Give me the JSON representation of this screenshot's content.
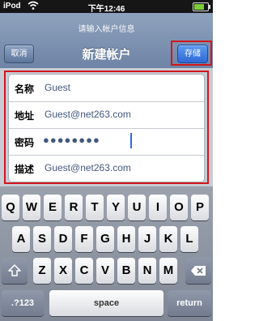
{
  "status": {
    "carrier": "iPod",
    "time": "下午12:46"
  },
  "nav": {
    "prompt": "请输入帐户信息",
    "title": "新建帐户",
    "cancel_label": "取消",
    "save_label": "存储"
  },
  "form": {
    "rows": [
      {
        "label": "名称",
        "value": "Guest"
      },
      {
        "label": "地址",
        "value": "Guest@net263.com"
      },
      {
        "label": "密码",
        "value": "●●●●●●●●"
      },
      {
        "label": "描述",
        "value": "Guest@net263.com"
      }
    ]
  },
  "keyboard": {
    "row1": [
      "Q",
      "W",
      "E",
      "R",
      "T",
      "Y",
      "U",
      "I",
      "O",
      "P"
    ],
    "row2": [
      "A",
      "S",
      "D",
      "F",
      "G",
      "H",
      "J",
      "K",
      "L"
    ],
    "row3": [
      "Z",
      "X",
      "C",
      "V",
      "B",
      "N",
      "M"
    ],
    "numbers_label": ".?123",
    "space_label": "space",
    "return_label": "return"
  }
}
